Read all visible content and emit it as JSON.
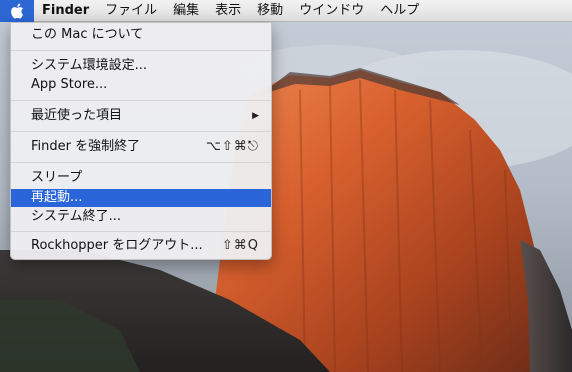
{
  "menubar": {
    "apple_menu_icon": "apple-icon",
    "titles": [
      "Finder",
      "ファイル",
      "編集",
      "表示",
      "移動",
      "ウインドウ",
      "ヘルプ"
    ]
  },
  "apple_menu": {
    "about": "この Mac について",
    "system_prefs": "システム環境設定...",
    "app_store": "App Store...",
    "recent_items": "最近使った項目",
    "recent_items_icon": "submenu-arrow-icon",
    "force_quit": "Finder を強制終了",
    "force_quit_shortcut": "⌥⇧⌘⎋",
    "sleep": "スリープ",
    "restart": "再起動...",
    "shutdown": "システム終了...",
    "logout": "Rockhopper をログアウト...",
    "logout_shortcut": "⇧⌘Q"
  },
  "colors": {
    "highlight": "#2a66d9",
    "apple_menu_active": "#2c67d4"
  }
}
